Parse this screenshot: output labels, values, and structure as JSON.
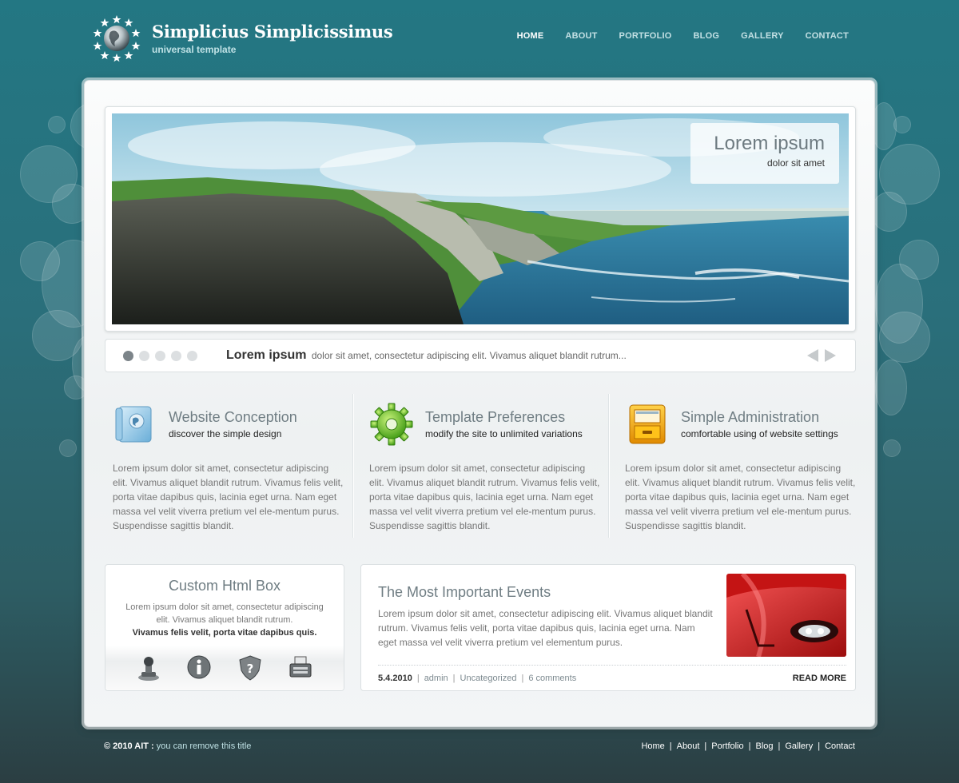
{
  "site": {
    "title": "Simplicius Simplicissimus",
    "subtitle": "universal template"
  },
  "nav": {
    "items": [
      {
        "label": "HOME",
        "active": true
      },
      {
        "label": "ABOUT"
      },
      {
        "label": "PORTFOLIO"
      },
      {
        "label": "BLOG"
      },
      {
        "label": "GALLERY"
      },
      {
        "label": "CONTACT"
      }
    ]
  },
  "slider": {
    "caption_title": "Lorem ipsum",
    "caption_sub": "dolor sit amet",
    "bar_title": "Lorem ipsum",
    "bar_text": "dolor sit amet, consectetur adipiscing elit. Vivamus aliquet blandit rutrum...",
    "dots": 5,
    "active_dot": 0
  },
  "features": [
    {
      "icon": "book-globe-icon",
      "title": "Website Conception",
      "subtitle": "discover the simple design",
      "text": "Lorem ipsum dolor sit amet, consectetur adipiscing elit. Vivamus aliquet blandit rutrum. Vivamus felis velit, porta vitae dapibus quis, lacinia eget urna. Nam eget massa vel velit viverra pretium vel ele-mentum purus. Suspendisse sagittis blandit."
    },
    {
      "icon": "gear-icon",
      "title": "Template Preferences",
      "subtitle": "modify the site to unlimited variations",
      "text": "Lorem ipsum dolor sit amet, consectetur adipiscing elit. Vivamus aliquet blandit rutrum. Vivamus felis velit, porta vitae dapibus quis, lacinia eget urna. Nam eget massa vel velit viverra pretium vel ele-mentum purus. Suspendisse sagittis blandit."
    },
    {
      "icon": "file-drawer-icon",
      "title": "Simple Administration",
      "subtitle": "comfortable using of website settings",
      "text": "Lorem ipsum dolor sit amet, consectetur adipiscing elit. Vivamus aliquet blandit rutrum. Vivamus felis velit, porta vitae dapibus quis, lacinia eget urna. Nam eget massa vel velit viverra pretium vel ele-mentum purus. Suspendisse sagittis blandit."
    }
  ],
  "custom_box": {
    "title": "Custom Html Box",
    "text": "Lorem ipsum dolor sit amet, consectetur adipiscing elit. Vivamus aliquet blandit rutrum.",
    "bold_text": "Vivamus felis velit, porta vitae dapibus quis.",
    "icons": [
      "stamp-icon",
      "info-icon",
      "shield-question-icon",
      "fax-icon"
    ]
  },
  "events": {
    "title": "The Most Important Events",
    "text": "Lorem ipsum dolor sit amet, consectetur adipiscing elit. Vivamus aliquet blandit rutrum. Vivamus felis velit, porta vitae dapibus quis, lacinia eget urna. Nam eget massa vel velit viverra pretium vel elementum purus.",
    "date": "5.4.2010",
    "author": "admin",
    "category": "Uncategorized",
    "comments": "6 comments",
    "read_more": "READ MORE"
  },
  "footer": {
    "copyright": "© 2010 AIT :",
    "note": "you can remove this title",
    "links": [
      "Home",
      "About",
      "Portfolio",
      "Blog",
      "Gallery",
      "Contact"
    ],
    "separator": "|"
  },
  "colors": {
    "accent": "#237783",
    "heading": "#6f7d83"
  }
}
